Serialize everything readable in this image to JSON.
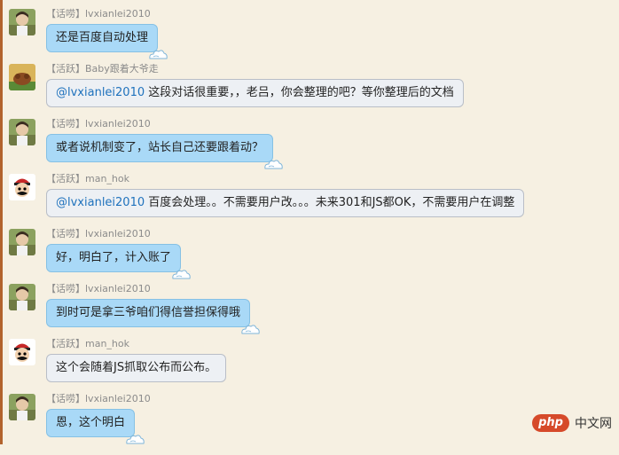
{
  "messages": [
    {
      "sender": "lvxianlei2010",
      "role": "【话唠】",
      "avatar": "lv",
      "style": "blue",
      "mention": "",
      "text": "还是百度自动处理"
    },
    {
      "sender": "Baby跟着大爷走",
      "role": "【活跃】",
      "avatar": "baby",
      "style": "gray",
      "mention": "@lvxianlei2010",
      "text": " 这段对话很重要，，老吕，你会整理的吧？等你整理后的文档"
    },
    {
      "sender": "lvxianlei2010",
      "role": "【话唠】",
      "avatar": "lv",
      "style": "blue",
      "mention": "",
      "text": "或者说机制变了，站长自己还要跟着动？"
    },
    {
      "sender": "man_hok",
      "role": "【活跃】",
      "avatar": "man",
      "style": "gray",
      "mention": "@lvxianlei2010",
      "text": " 百度会处理。。不需要用户改。。。未来301和JS都OK，不需要用户在调整"
    },
    {
      "sender": "lvxianlei2010",
      "role": "【话唠】",
      "avatar": "lv",
      "style": "blue",
      "mention": "",
      "text": "好，明白了，计入账了"
    },
    {
      "sender": "lvxianlei2010",
      "role": "【话唠】",
      "avatar": "lv",
      "style": "blue",
      "mention": "",
      "text": "到时可是拿三爷咱们得信誉担保得哦"
    },
    {
      "sender": "man_hok",
      "role": "【活跃】",
      "avatar": "man",
      "style": "gray",
      "mention": "",
      "text": "这个会随着JS抓取公布而公布。"
    },
    {
      "sender": "lvxianlei2010",
      "role": "【话唠】",
      "avatar": "lv",
      "style": "blue",
      "mention": "",
      "text": "恩，这个明白"
    }
  ],
  "watermark": {
    "logo": "php",
    "text": "中文网"
  }
}
